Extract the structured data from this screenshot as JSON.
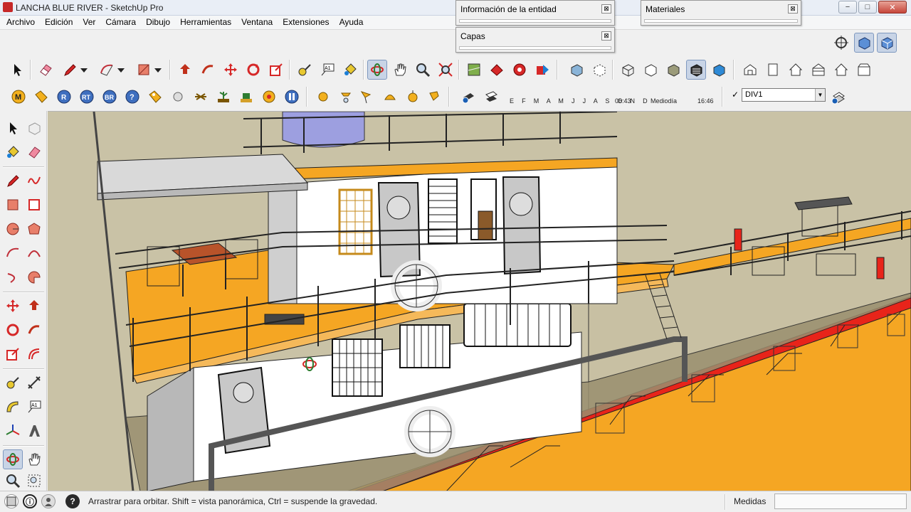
{
  "window": {
    "title": "LANCHA BLUE RIVER - SketchUp Pro",
    "controls": {
      "minimize": "−",
      "maximize": "□",
      "close": "✕"
    }
  },
  "menu": [
    "Archivo",
    "Edición",
    "Ver",
    "Cámara",
    "Dibujo",
    "Herramientas",
    "Ventana",
    "Extensiones",
    "Ayuda"
  ],
  "panels": {
    "entity_info": {
      "title": "Información de la entidad",
      "close": "⊠"
    },
    "layers": {
      "title": "Capas",
      "close": "⊠"
    },
    "materials": {
      "title": "Materiales",
      "close": "⊠"
    }
  },
  "toolbar": {
    "row2_badges": [
      "M",
      "R",
      "RT",
      "BR",
      "?"
    ],
    "shadow_months": "E F M A M J J A S O N D",
    "time_start": "06:43",
    "time_mid": "Mediodía",
    "time_end": "16:46",
    "scene_value": "DIV1",
    "label_text_tool": "A1"
  },
  "status": {
    "hint": "Arrastrar para orbitar. Shift = vista panorámica, Ctrl = suspende la gravedad.",
    "measures_label": "Medidas",
    "measures_value": ""
  },
  "colors": {
    "deck_orange": "#f5a623",
    "hull_red": "#e8241a",
    "water": "#c9c2a6",
    "cabin_white": "#ffffff",
    "accent_blue": "#9d9fe0"
  }
}
